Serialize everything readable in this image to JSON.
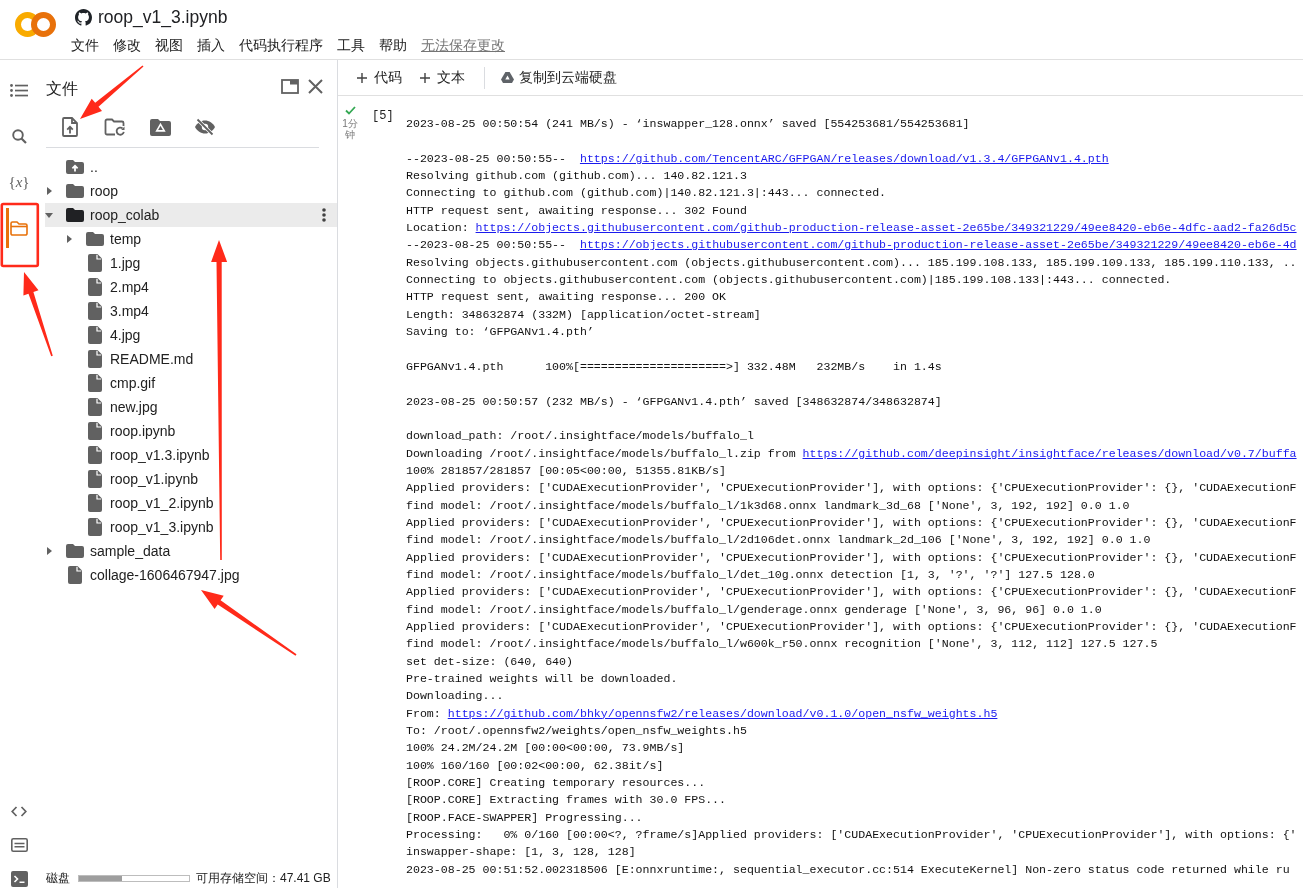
{
  "header": {
    "title": "roop_v1_3.ipynb",
    "menu": [
      "文件",
      "修改",
      "视图",
      "插入",
      "代码执行程序",
      "工具",
      "帮助"
    ],
    "save_notice": "无法保存更改"
  },
  "left_rail": {
    "top": [
      {
        "kind": "toc",
        "selected": false
      },
      {
        "kind": "search",
        "selected": false
      },
      {
        "kind": "variables",
        "glyph": "{*x*}",
        "selected": false
      },
      {
        "kind": "files",
        "selected": true
      }
    ],
    "bottom": [
      {
        "kind": "snippets",
        "selected": false
      },
      {
        "kind": "palette",
        "selected": false
      },
      {
        "kind": "terminal",
        "selected": false
      }
    ]
  },
  "files_panel": {
    "title": "文件",
    "tree": [
      {
        "kind": "parent",
        "name": "..",
        "selected": false
      },
      {
        "kind": "folder",
        "name": "roop",
        "expanded": false,
        "selected": false
      },
      {
        "kind": "folder",
        "name": "roop_colab",
        "expanded": true,
        "selected": true,
        "children": [
          {
            "kind": "folder",
            "name": "temp",
            "expanded": false,
            "selected": false
          },
          {
            "kind": "file",
            "name": "1.jpg",
            "selected": false
          },
          {
            "kind": "file",
            "name": "2.mp4",
            "selected": false
          },
          {
            "kind": "file",
            "name": "3.mp4",
            "selected": false
          },
          {
            "kind": "file",
            "name": "4.jpg",
            "selected": false
          },
          {
            "kind": "file",
            "name": "README.md",
            "selected": false
          },
          {
            "kind": "file",
            "name": "cmp.gif",
            "selected": false
          },
          {
            "kind": "file",
            "name": "new.jpg",
            "selected": false
          },
          {
            "kind": "file",
            "name": "roop.ipynb",
            "selected": false
          },
          {
            "kind": "file",
            "name": "roop_v1.3.ipynb",
            "selected": false
          },
          {
            "kind": "file",
            "name": "roop_v1.ipynb",
            "selected": false
          },
          {
            "kind": "file",
            "name": "roop_v1_2.ipynb",
            "selected": false
          },
          {
            "kind": "file",
            "name": "roop_v1_3.ipynb",
            "selected": false
          }
        ]
      },
      {
        "kind": "folder",
        "name": "sample_data",
        "expanded": false,
        "selected": false
      },
      {
        "kind": "file",
        "name": "collage-1606467947.jpg",
        "selected": false
      }
    ],
    "disk": {
      "label": "磁盘",
      "level": 0.39,
      "free": "可用存储空间：47.41 GB"
    }
  },
  "toolbar": [
    {
      "kind": "add",
      "label": "代码"
    },
    {
      "kind": "add",
      "label": "文本"
    },
    {
      "kind": "drive",
      "label": "复制到云端硬盘"
    }
  ],
  "cell": {
    "completed": true,
    "elapsed": "1分钟",
    "execution_count": "[5]",
    "output": [
      [
        {
          "text": "2023-08-25 00:50:54 (241 MB/s) - ‘inswapper_128.onnx’ saved [554253681/554253681]"
        }
      ],
      [
        {
          "text": "--2023-08-25 00:50:55--  ",
          "link": "https://github.com/TencentARC/GFPGAN/releases/download/v1.3.4/GFPGANv1.4.pth"
        },
        {
          "text": "Resolving github.com (github.com)... 140.82.121.3"
        },
        {
          "text": "Connecting to github.com (github.com)|140.82.121.3|:443... connected."
        },
        {
          "text": "HTTP request sent, awaiting response... 302 Found"
        },
        {
          "text": "Location: ",
          "link": "https://objects.githubusercontent.com/github-production-release-asset-2e65be/349321229/49ee8420-eb6e-4dfc-aad2-fa26d5c"
        },
        {
          "text": "--2023-08-25 00:50:55--  ",
          "link": "https://objects.githubusercontent.com/github-production-release-asset-2e65be/349321229/49ee8420-eb6e-4d"
        },
        {
          "text": "Resolving objects.githubusercontent.com (objects.githubusercontent.com)... 185.199.108.133, 185.199.109.133, 185.199.110.133, .."
        },
        {
          "text": "Connecting to objects.githubusercontent.com (objects.githubusercontent.com)|185.199.108.133|:443... connected."
        },
        {
          "text": "HTTP request sent, awaiting response... 200 OK"
        },
        {
          "text": "Length: 348632874 (332M) [application/octet-stream]"
        },
        {
          "text": "Saving to: ‘GFPGANv1.4.pth’"
        }
      ],
      [
        {
          "text": "GFPGANv1.4.pth      100%[=====================>] 332.48M   232MB/s    in 1.4s"
        }
      ],
      [
        {
          "text": "2023-08-25 00:50:57 (232 MB/s) - ‘GFPGANv1.4.pth’ saved [348632874/348632874]"
        }
      ],
      [
        {
          "text": "download_path: /root/.insightface/models/buffalo_l"
        },
        {
          "text": "Downloading /root/.insightface/models/buffalo_l.zip from ",
          "link": "https://github.com/deepinsight/insightface/releases/download/v0.7/buffa"
        },
        {
          "text": "100% 281857/281857 [00:05<00:00, 51355.81KB/s]"
        },
        {
          "text": "Applied providers: ['CUDAExecutionProvider', 'CPUExecutionProvider'], with options: {'CPUExecutionProvider': {}, 'CUDAExecutionF"
        },
        {
          "text": "find model: /root/.insightface/models/buffalo_l/1k3d68.onnx landmark_3d_68 ['None', 3, 192, 192] 0.0 1.0"
        },
        {
          "text": "Applied providers: ['CUDAExecutionProvider', 'CPUExecutionProvider'], with options: {'CPUExecutionProvider': {}, 'CUDAExecutionF"
        },
        {
          "text": "find model: /root/.insightface/models/buffalo_l/2d106det.onnx landmark_2d_106 ['None', 3, 192, 192] 0.0 1.0"
        },
        {
          "text": "Applied providers: ['CUDAExecutionProvider', 'CPUExecutionProvider'], with options: {'CPUExecutionProvider': {}, 'CUDAExecutionF"
        },
        {
          "text": "find model: /root/.insightface/models/buffalo_l/det_10g.onnx detection [1, 3, '?', '?'] 127.5 128.0"
        },
        {
          "text": "Applied providers: ['CUDAExecutionProvider', 'CPUExecutionProvider'], with options: {'CPUExecutionProvider': {}, 'CUDAExecutionF"
        },
        {
          "text": "find model: /root/.insightface/models/buffalo_l/genderage.onnx genderage ['None', 3, 96, 96] 0.0 1.0"
        },
        {
          "text": "Applied providers: ['CUDAExecutionProvider', 'CPUExecutionProvider'], with options: {'CPUExecutionProvider': {}, 'CUDAExecutionF"
        },
        {
          "text": "find model: /root/.insightface/models/buffalo_l/w600k_r50.onnx recognition ['None', 3, 112, 112] 127.5 127.5"
        },
        {
          "text": "set det-size: (640, 640)"
        },
        {
          "text": "Pre-trained weights will be downloaded."
        },
        {
          "text": "Downloading..."
        },
        {
          "text": "From: ",
          "link": "https://github.com/bhky/opennsfw2/releases/download/v0.1.0/open_nsfw_weights.h5"
        },
        {
          "text": "To: /root/.opennsfw2/weights/open_nsfw_weights.h5"
        },
        {
          "text": "100% 24.2M/24.2M [00:00<00:00, 73.9MB/s]"
        },
        {
          "text": "100% 160/160 [00:02<00:00, 62.38it/s]"
        },
        {
          "text": "[ROOP.CORE] Creating temporary resources..."
        },
        {
          "text": "[ROOP.CORE] Extracting frames with 30.0 FPS..."
        },
        {
          "text": "[ROOP.FACE-SWAPPER] Progressing..."
        },
        {
          "text": "Processing:   0% 0/160 [00:00<?, ?frame/s]Applied providers: ['CUDAExecutionProvider', 'CPUExecutionProvider'], with options: {'"
        },
        {
          "text": "inswapper-shape: [1, 3, 128, 128]"
        },
        {
          "text": "2023-08-25 00:51:52.002318506 [E:onnxruntime:, sequential_executor.cc:514 ExecuteKernel] Non-zero status code returned while ru"
        }
      ]
    ]
  }
}
